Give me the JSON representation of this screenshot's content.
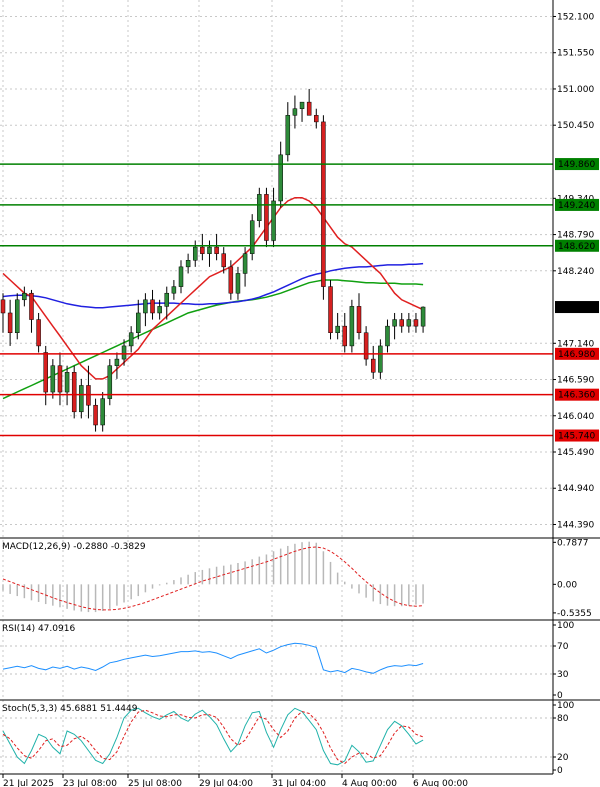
{
  "chart_data": {
    "type": "candlestick",
    "symbol": "USDJPY",
    "main": {
      "price_axis": [
        "152.100",
        "151.550",
        "151.000",
        "150.450",
        "149.340",
        "148.790",
        "148.240",
        "147.140",
        "146.590",
        "146.040",
        "145.490",
        "144.940",
        "144.390"
      ],
      "ylim": [
        144.2,
        152.35
      ],
      "current_price": "147.690",
      "resistance_levels": [
        "149.860",
        "149.240",
        "148.620"
      ],
      "support_levels": [
        "146.980",
        "146.360",
        "145.740"
      ],
      "colors": {
        "up": "#2e8b3a",
        "down": "#d62020",
        "ma_fast": "#e02020",
        "ma_mid": "#2020e0",
        "ma_slow": "#10a010",
        "resistance": "#008000",
        "support": "#e00000",
        "current_bg": "#000000",
        "current_fg": "#ffffff"
      },
      "candles": [
        [
          147.8,
          147.9,
          147.3,
          147.6
        ],
        [
          147.6,
          147.8,
          147.1,
          147.3
        ],
        [
          147.3,
          147.9,
          147.2,
          147.8
        ],
        [
          147.8,
          148.0,
          147.7,
          147.9
        ],
        [
          147.9,
          147.95,
          147.3,
          147.5
        ],
        [
          147.5,
          147.6,
          147.0,
          147.1
        ],
        [
          147.0,
          147.1,
          146.2,
          146.4
        ],
        [
          146.4,
          146.9,
          146.3,
          146.8
        ],
        [
          146.8,
          147.0,
          146.2,
          146.4
        ],
        [
          146.4,
          146.8,
          146.2,
          146.7
        ],
        [
          146.7,
          146.8,
          146.0,
          146.1
        ],
        [
          146.1,
          146.6,
          146.0,
          146.5
        ],
        [
          146.5,
          146.8,
          146.0,
          146.2
        ],
        [
          146.2,
          146.3,
          145.8,
          145.9
        ],
        [
          145.9,
          146.4,
          145.8,
          146.3
        ],
        [
          146.3,
          146.9,
          146.2,
          146.8
        ],
        [
          146.8,
          147.0,
          146.6,
          146.9
        ],
        [
          146.9,
          147.2,
          146.8,
          147.1
        ],
        [
          147.1,
          147.4,
          147.0,
          147.3
        ],
        [
          147.3,
          147.8,
          147.2,
          147.6
        ],
        [
          147.6,
          147.9,
          147.4,
          147.8
        ],
        [
          147.8,
          147.95,
          147.5,
          147.6
        ],
        [
          147.6,
          147.8,
          147.5,
          147.7
        ],
        [
          147.7,
          148.0,
          147.5,
          147.9
        ],
        [
          147.9,
          148.1,
          147.8,
          148.0
        ],
        [
          148.0,
          148.4,
          147.9,
          148.3
        ],
        [
          148.3,
          148.5,
          148.2,
          148.4
        ],
        [
          148.4,
          148.7,
          148.3,
          148.6
        ],
        [
          148.6,
          148.8,
          148.4,
          148.5
        ],
        [
          148.5,
          148.7,
          148.3,
          148.6
        ],
        [
          148.6,
          148.8,
          148.4,
          148.5
        ],
        [
          148.5,
          148.6,
          148.2,
          148.3
        ],
        [
          148.3,
          148.4,
          147.8,
          147.9
        ],
        [
          147.9,
          148.3,
          147.8,
          148.2
        ],
        [
          148.2,
          148.6,
          148.0,
          148.5
        ],
        [
          148.5,
          149.1,
          148.4,
          149.0
        ],
        [
          149.0,
          149.5,
          148.9,
          149.4
        ],
        [
          149.4,
          149.5,
          148.6,
          148.7
        ],
        [
          148.7,
          149.5,
          148.6,
          149.3
        ],
        [
          149.3,
          150.2,
          149.2,
          150.0
        ],
        [
          150.0,
          150.8,
          149.9,
          150.6
        ],
        [
          150.6,
          150.9,
          150.4,
          150.7
        ],
        [
          150.7,
          150.8,
          150.5,
          150.8
        ],
        [
          150.8,
          151.0,
          150.6,
          150.6
        ],
        [
          150.6,
          150.7,
          150.4,
          150.5
        ],
        [
          150.5,
          150.6,
          147.8,
          148.0
        ],
        [
          148.0,
          148.1,
          147.2,
          147.3
        ],
        [
          147.3,
          147.6,
          147.2,
          147.4
        ],
        [
          147.4,
          147.6,
          147.0,
          147.1
        ],
        [
          147.1,
          147.8,
          147.0,
          147.7
        ],
        [
          147.7,
          147.9,
          147.2,
          147.3
        ],
        [
          147.3,
          147.4,
          146.8,
          146.9
        ],
        [
          146.9,
          147.1,
          146.6,
          146.7
        ],
        [
          146.7,
          147.2,
          146.6,
          147.1
        ],
        [
          147.1,
          147.5,
          147.0,
          147.4
        ],
        [
          147.4,
          147.6,
          147.2,
          147.5
        ],
        [
          147.5,
          147.6,
          147.3,
          147.4
        ],
        [
          147.4,
          147.6,
          147.3,
          147.5
        ],
        [
          147.5,
          147.6,
          147.3,
          147.4
        ],
        [
          147.4,
          147.7,
          147.3,
          147.69
        ]
      ],
      "ma_fast": [
        148.2,
        148.1,
        148.0,
        147.9,
        147.85,
        147.7,
        147.55,
        147.4,
        147.25,
        147.1,
        146.95,
        146.8,
        146.7,
        146.6,
        146.6,
        146.65,
        146.75,
        146.85,
        146.95,
        147.05,
        147.2,
        147.35,
        147.45,
        147.55,
        147.65,
        147.75,
        147.85,
        147.95,
        148.05,
        148.15,
        148.2,
        148.25,
        148.3,
        148.4,
        148.5,
        148.6,
        148.75,
        148.9,
        149.05,
        149.2,
        149.3,
        149.35,
        149.35,
        149.3,
        149.2,
        149.05,
        148.9,
        148.75,
        148.65,
        148.6,
        148.5,
        148.4,
        148.3,
        148.2,
        148.05,
        147.9,
        147.8,
        147.75,
        147.7,
        147.65
      ],
      "ma_mid": [
        147.85,
        147.86,
        147.87,
        147.87,
        147.86,
        147.85,
        147.83,
        147.8,
        147.77,
        147.74,
        147.72,
        147.7,
        147.69,
        147.68,
        147.68,
        147.69,
        147.7,
        147.71,
        147.72,
        147.73,
        147.74,
        147.75,
        147.75,
        147.75,
        147.75,
        147.74,
        147.74,
        147.73,
        147.73,
        147.74,
        147.74,
        147.75,
        147.76,
        147.77,
        147.79,
        147.81,
        147.84,
        147.88,
        147.92,
        147.97,
        148.02,
        148.07,
        148.12,
        148.16,
        148.19,
        148.21,
        148.24,
        148.26,
        148.28,
        148.29,
        148.3,
        148.3,
        148.31,
        148.32,
        148.33,
        148.33,
        148.33,
        148.34,
        148.34,
        148.35
      ],
      "ma_slow": [
        146.3,
        146.35,
        146.4,
        146.45,
        146.5,
        146.55,
        146.6,
        146.65,
        146.7,
        146.75,
        146.8,
        146.85,
        146.9,
        146.95,
        147.0,
        147.05,
        147.1,
        147.15,
        147.2,
        147.25,
        147.3,
        147.35,
        147.4,
        147.45,
        147.5,
        147.55,
        147.6,
        147.63,
        147.66,
        147.69,
        147.72,
        147.74,
        147.76,
        147.78,
        147.79,
        147.8,
        147.82,
        147.84,
        147.87,
        147.9,
        147.94,
        147.98,
        148.02,
        148.06,
        148.08,
        148.1,
        148.1,
        148.1,
        148.09,
        148.08,
        148.07,
        148.06,
        148.06,
        148.05,
        148.05,
        148.05,
        148.04,
        148.04,
        148.04,
        148.03
      ]
    },
    "macd": {
      "label": "MACD(12,26,9) -0.2880 -0.3829",
      "axis": [
        "0.7877",
        "0.00",
        "-0.5355"
      ],
      "ylim": [
        -0.65,
        0.85
      ],
      "hist": [
        -0.12,
        -0.18,
        -0.22,
        -0.26,
        -0.3,
        -0.33,
        -0.37,
        -0.4,
        -0.43,
        -0.46,
        -0.49,
        -0.51,
        -0.52,
        -0.52,
        -0.5,
        -0.46,
        -0.4,
        -0.34,
        -0.28,
        -0.22,
        -0.15,
        -0.08,
        -0.02,
        0.03,
        0.08,
        0.13,
        0.18,
        0.23,
        0.27,
        0.3,
        0.33,
        0.35,
        0.37,
        0.4,
        0.43,
        0.47,
        0.52,
        0.56,
        0.62,
        0.67,
        0.72,
        0.76,
        0.79,
        0.8,
        0.78,
        0.62,
        0.42,
        0.22,
        0.05,
        -0.08,
        -0.17,
        -0.25,
        -0.32,
        -0.37,
        -0.4,
        -0.41,
        -0.41,
        -0.4,
        -0.38,
        -0.36
      ],
      "signal": [
        0.1,
        0.05,
        0.0,
        -0.05,
        -0.1,
        -0.15,
        -0.2,
        -0.25,
        -0.3,
        -0.34,
        -0.38,
        -0.42,
        -0.45,
        -0.47,
        -0.48,
        -0.48,
        -0.47,
        -0.45,
        -0.42,
        -0.38,
        -0.34,
        -0.29,
        -0.24,
        -0.19,
        -0.14,
        -0.09,
        -0.04,
        0.01,
        0.06,
        0.1,
        0.14,
        0.18,
        0.22,
        0.26,
        0.3,
        0.34,
        0.38,
        0.42,
        0.47,
        0.52,
        0.57,
        0.62,
        0.66,
        0.69,
        0.7,
        0.68,
        0.62,
        0.53,
        0.42,
        0.3,
        0.17,
        0.05,
        -0.06,
        -0.16,
        -0.25,
        -0.32,
        -0.37,
        -0.4,
        -0.41,
        -0.4
      ]
    },
    "rsi": {
      "label": "RSI(14) 47.0916",
      "axis": [
        "100",
        "70",
        "30",
        "0"
      ],
      "ylim": [
        0,
        100
      ],
      "values": [
        37,
        39,
        41,
        39,
        42,
        38,
        36,
        40,
        38,
        41,
        37,
        40,
        38,
        35,
        40,
        46,
        48,
        51,
        53,
        55,
        57,
        55,
        56,
        58,
        60,
        62,
        62,
        63,
        61,
        62,
        60,
        56,
        52,
        57,
        60,
        63,
        66,
        60,
        64,
        69,
        72,
        74,
        73,
        71,
        68,
        36,
        33,
        35,
        32,
        38,
        36,
        33,
        31,
        36,
        40,
        42,
        41,
        43,
        42,
        45
      ]
    },
    "stoch": {
      "label": "Stoch(5,3,3) 45.6881 51.4449",
      "axis": [
        "100",
        "80",
        "20",
        "0"
      ],
      "ylim": [
        0,
        100
      ],
      "main": [
        60,
        40,
        20,
        10,
        30,
        55,
        50,
        35,
        25,
        60,
        55,
        45,
        30,
        15,
        10,
        25,
        50,
        80,
        92,
        95,
        88,
        82,
        78,
        85,
        90,
        80,
        75,
        86,
        92,
        82,
        70,
        48,
        28,
        40,
        68,
        88,
        90,
        58,
        35,
        62,
        85,
        95,
        90,
        76,
        62,
        30,
        10,
        8,
        14,
        38,
        28,
        12,
        14,
        38,
        62,
        75,
        68,
        55,
        40,
        46
      ],
      "signal": [
        55,
        48,
        34,
        22,
        18,
        30,
        45,
        48,
        36,
        38,
        48,
        52,
        44,
        30,
        18,
        16,
        28,
        52,
        74,
        89,
        92,
        88,
        83,
        82,
        85,
        85,
        81,
        80,
        85,
        85,
        81,
        66,
        48,
        38,
        46,
        64,
        82,
        78,
        62,
        50,
        60,
        80,
        90,
        87,
        76,
        58,
        34,
        16,
        10,
        20,
        26,
        26,
        18,
        22,
        38,
        57,
        68,
        66,
        55,
        51
      ]
    },
    "time_axis": [
      "21 Jul 2025",
      "23 Jul 08:00",
      "25 Jul 08:00",
      "29 Jul 04:00",
      "31 Jul 04:00",
      "4 Aug 00:00",
      "6 Aug 00:00"
    ]
  }
}
